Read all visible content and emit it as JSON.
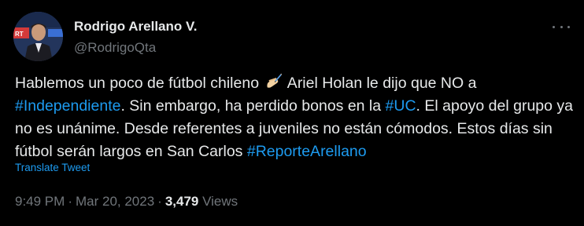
{
  "author": {
    "display_name": "Rodrigo Arellano V.",
    "handle": "@RodrigoQta"
  },
  "menu": {
    "icon": "more-horizontal-icon"
  },
  "tweet": {
    "segment_1": "Hablemos un poco de fútbol chileno ",
    "emoji": "writing-hand-emoji",
    "segment_2": " Ariel Holan le dijo que NO a ",
    "hashtag_1": "#Independiente",
    "segment_3": ". Sin embargo, ha perdido bonos en la ",
    "hashtag_2": "#UC",
    "segment_4": ". El apoyo del grupo ya no es unánime. Desde referentes a juveniles no están cómodos. Estos días sin fútbol serán largos en San Carlos ",
    "hashtag_3": "#ReporteArellano"
  },
  "translate_label": "Translate Tweet",
  "meta": {
    "time": "9:49 PM",
    "separator": "·",
    "date": "Mar 20, 2023",
    "views_count": "3,479",
    "views_label": "Views"
  },
  "colors": {
    "background": "#000000",
    "text": "#e7e9ea",
    "secondary": "#71767b",
    "link": "#1d9bf0"
  }
}
